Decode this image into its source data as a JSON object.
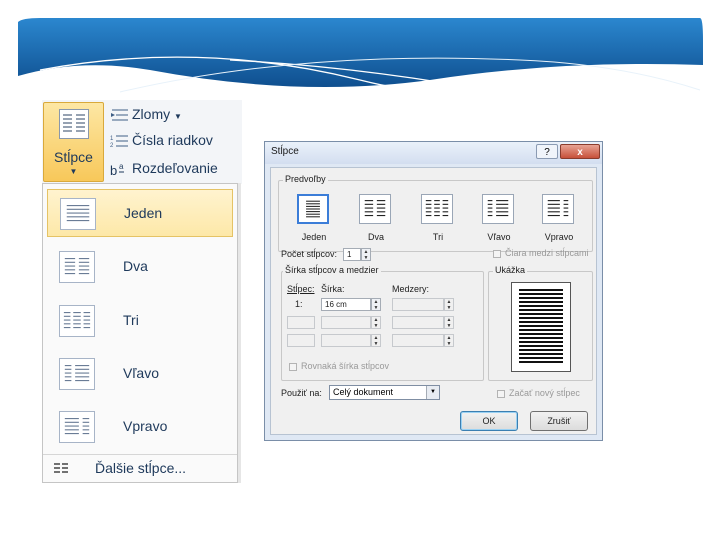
{
  "ribbon": {
    "columns_button_label": "Stĺpce",
    "columns_button_icon": "columns-icon",
    "side_items": [
      {
        "label": "Zlomy",
        "icon": "breaks-icon"
      },
      {
        "label": "Čísla riadkov",
        "icon": "line-numbers-icon"
      },
      {
        "label": "Rozdeľovanie",
        "icon": "hyphenation-icon"
      }
    ]
  },
  "dropdown": {
    "items": [
      {
        "label": "Jeden",
        "selected": true,
        "columns": 1
      },
      {
        "label": "Dva",
        "columns": 2
      },
      {
        "label": "Tri",
        "columns": 3
      },
      {
        "label": "Vľavo",
        "columns": "left"
      },
      {
        "label": "Vpravo",
        "columns": "right"
      }
    ],
    "more_label": "Ďalšie stĺpce..."
  },
  "dialog": {
    "title": "Stĺpce",
    "help_label": "?",
    "close_label": "x",
    "presets_legend": "Predvoľby",
    "presets": [
      {
        "label": "Jeden",
        "selected": true
      },
      {
        "label": "Dva"
      },
      {
        "label": "Tri"
      },
      {
        "label": "Vľavo"
      },
      {
        "label": "Vpravo"
      }
    ],
    "num_columns_label": "Počet stĺpcov:",
    "num_columns_value": "1",
    "line_between_label": "Čiara medzi stĺpcami",
    "width_spacing_legend": "Šírka stĺpcov a medzier",
    "preview_legend": "Ukážka",
    "col_header": "Stĺpec:",
    "width_header": "Šírka:",
    "spacing_header": "Medzery:",
    "row1_col": "1:",
    "row1_width": "16 cm",
    "equal_width_label": "Rovnaká šírka stĺpcov",
    "apply_to_label": "Použiť na:",
    "apply_to_value": "Celý dokument",
    "new_column_label": "Začať nový stĺpec",
    "ok_label": "OK",
    "cancel_label": "Zrušiť"
  },
  "colors": {
    "banner_blue": "#1f6fb8",
    "ribbon_text": "#1e395b",
    "highlight": "#fbd56e"
  }
}
